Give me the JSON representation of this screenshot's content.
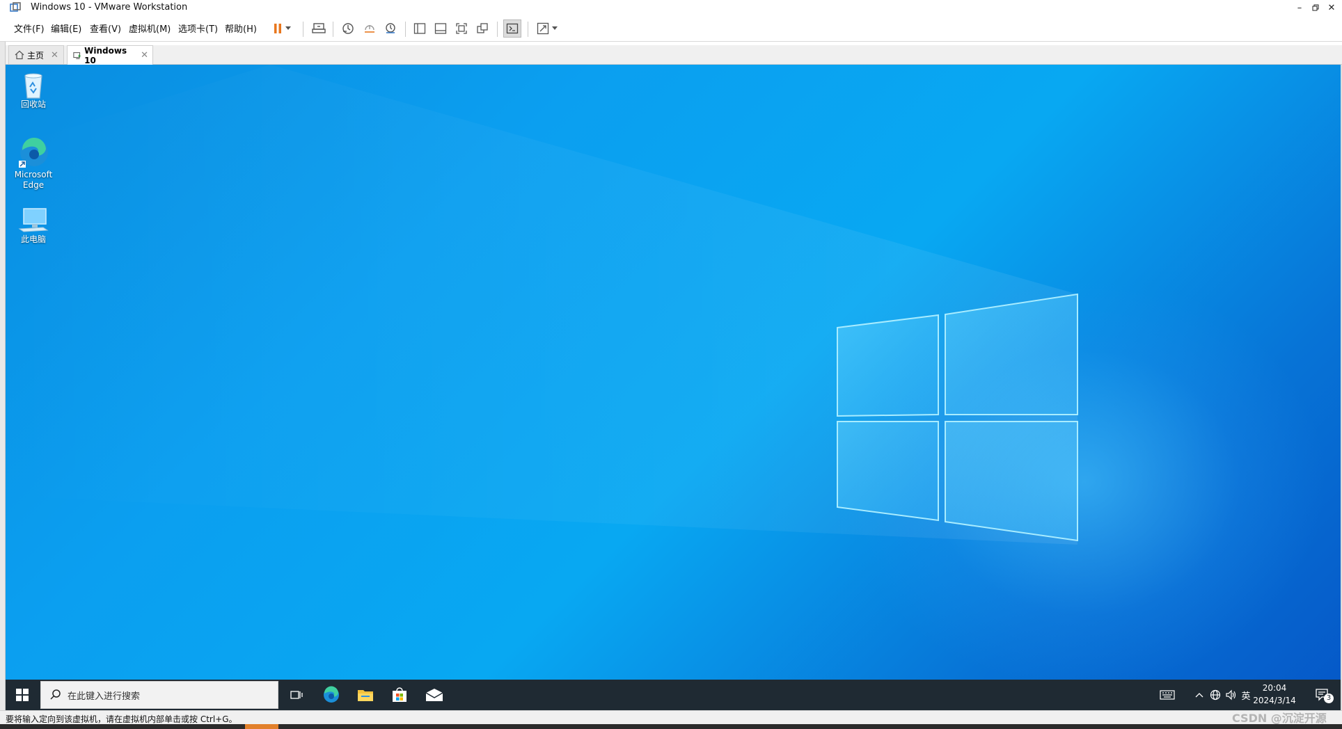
{
  "window": {
    "title": "Windows 10 - VMware Workstation",
    "minimize_icon": "minimize-icon",
    "maximize_icon": "restore-icon",
    "close_icon": "close-icon"
  },
  "menu": {
    "items": [
      "文件(F)",
      "编辑(E)",
      "查看(V)",
      "虚拟机(M)",
      "选项卡(T)",
      "帮助(H)"
    ]
  },
  "toolbar": {
    "icons": [
      "pause-icon",
      "dropdown-arrow-icon",
      "send-ctrl-alt-del-icon",
      "snapshot-icon",
      "revert-snapshot-icon",
      "snapshot-manager-icon",
      "library-view-icon",
      "thumbnail-bar-icon",
      "full-screen-icon",
      "unity-icon",
      "console-view-icon",
      "stretch-guest-icon",
      "dropdown-arrow-icon"
    ],
    "accent_color": "#e8771e"
  },
  "tabs": [
    {
      "label": "主页",
      "icon": "home-icon",
      "active": false
    },
    {
      "label": "Windows 10",
      "icon": "vm-icon",
      "active": true
    }
  ],
  "desktop": {
    "wallpaper_colors": [
      "#0a8de0",
      "#08a8f2",
      "#0557c7"
    ],
    "icons": [
      {
        "label": "回收站",
        "icon": "recycle-bin-icon"
      },
      {
        "label_line1": "Microsoft",
        "label_line2": "Edge",
        "icon": "edge-icon"
      },
      {
        "label": "此电脑",
        "icon": "this-pc-icon"
      }
    ]
  },
  "taskbar": {
    "search_placeholder": "在此键入进行搜索",
    "apps": [
      "task-view-icon",
      "edge-icon",
      "file-explorer-icon",
      "store-icon",
      "mail-icon"
    ],
    "tray": {
      "ime_mode_icon": "keyboard-icon",
      "overflow_icon": "chevron-up-icon",
      "network_icon": "network-icon",
      "volume_icon": "volume-icon",
      "language": "英",
      "time": "20:04",
      "date": "2024/3/14",
      "notification_count": "3"
    }
  },
  "statusbar": {
    "message": "要将输入定向到该虚拟机，请在虚拟机内部单击或按 Ctrl+G。"
  },
  "watermark": "CSDN @沉淀开源"
}
